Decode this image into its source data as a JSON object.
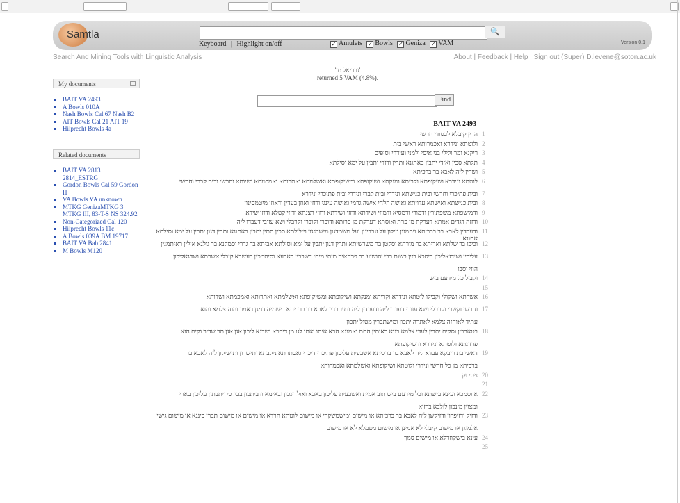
{
  "header": {
    "logo_text": "Samtla",
    "search": {
      "value": "",
      "placeholder": ""
    },
    "search_button": "🔍",
    "keyboard_link": "Keyboard",
    "separator": "|",
    "highlight_link": "Highlight on/off",
    "filters": [
      {
        "label": "Amulets",
        "checked": true
      },
      {
        "label": "Bowls",
        "checked": true
      },
      {
        "label": "Geniza",
        "checked": true
      },
      {
        "label": "VAM",
        "checked": true
      }
    ],
    "version": "Version 0.1"
  },
  "tagline": "Search And Mining Tools with Linguistic Analysis",
  "top_links": "About | Feedback | Help | Sign out (Super) D.levene@soton.ac.uk",
  "sidebar": {
    "my_documents_title": "My documents",
    "my_documents": [
      "BAIT VA 2493",
      "A Bowls 010A",
      "Nash Bowls Cal 67 Nash B2",
      "AIT Bowls Cal 21 AIT 19",
      "Hilprecht Bowls 4a"
    ],
    "related_title": "Related documents",
    "related": [
      "BAIT VA 2813 + 2814_ESTRG",
      "Gordon Bowls Cal 59 Gordon H",
      "VA Bowls VA unknown",
      "MTKG GenizaMTKG 3 MTKG III, 83-T-S NS 324.92",
      "Non-Categorized Cal 120",
      "Hilprecht Bowls 11c",
      "A Bowls 039A BM 19717",
      "BAIT VA Bab 2841",
      "M Bowls M120"
    ]
  },
  "results": {
    "query": "'גבריאל מן'",
    "summary": "returned 5 VAM (4.8%).",
    "find_value": "",
    "find_button": "Find"
  },
  "document": {
    "title": "BAIT VA 2493",
    "lines": [
      {
        "n": "1",
        "t": "הדין קיבלא לבסודי חרשי"
      },
      {
        "n": "2",
        "t": "ולוטתא ונידרא ואכמרותא ראשי בית"
      },
      {
        "n": "3",
        "t": "ריקנא ומר ולילי בני איסי ולמני ועידרי וסיפים"
      },
      {
        "n": "4",
        "t": "תלתא סכין ואזדי יתבין באתונא ותרין ודזדי יתבין על ימא וסילתא"
      },
      {
        "n": "5",
        "t": "ושרין ליה לאבא בר ברכיתא"
      },
      {
        "n": "6",
        "t": "לוטתא ונידרא ושיקופתא וקריתא ומנקתא ושיקופתא ומשיקופתא ואשלמתא ואתרותא ואמכמתא ושיותא וחרשי ובית קברי וחרשי"
      },
      {
        "n": "7",
        "t": "ובית פתיכרי וחרשי ובית כנישתא ונידרי ובית קברי ונידרי ובית פתיכרי ונידרא"
      },
      {
        "n": "8",
        "t": "ובית כנישתא ואישתא עדויתא ואישה הלחי אישה גרמי ואישה עינגי ודזזי ואוזן בעדין ודאוזן מיטמסינון"
      },
      {
        "n": "9",
        "t": "ודמישפתא משפתורין ודמורי ודמסיא ודמוזי ושידתא ודזזי ושידתא ודזזי רצנתא ודזזי קטלא ודזזי שידא"
      },
      {
        "n": "10",
        "t": "ודזזה דגדים אמתא דערקת מן פרת ואוסתא דערקת מן פרותא ודוכרי וקוברי וקרבלי ושא עזובי דעבדו ליה"
      },
      {
        "n": "11",
        "t": "ודעבדין לאבא בר ברכיתא ויתמנון ויילון על עבדיגון ועל משמדגון מישמזגון ויילולתא סכין תתין יתבין באתונא ותרין דגון יתבין על ימא וסילתא אתונא"
      },
      {
        "n": "12",
        "t": "וכיכו בר שלתא ואריתא בר מורתא וסקטן בר משרשיתא ותרין דגון יתבין על ימא וסילתא אביתא בר גדרי וסמקנא בר גולגא אילין ראיתמנין"
      },
      {
        "n": "13",
        "t": "עליכין ושידגאליכון דיסכא בזין בשום רבי יהושוע בר פרחאיה מיתי מיתי דשבבין בארעא וסיתמכין בעשרא קיבלי אשרתא ושדגאליכון"
      },
      {
        "n": "",
        "t": "הוזי וסבו"
      },
      {
        "n": "14",
        "t": "וקביל כל מידעם ביש"
      },
      {
        "n": "15",
        "t": ""
      },
      {
        "n": "16",
        "t": "אשרתא ושקולי וקבילו לוטתא ונידרא וקריתא ומנקתא ושיקופתא ומשיקופתא ואשלמתא ואתרותא ואמכמתא ושדותא"
      },
      {
        "n": "17",
        "t": "וחרשי וקשרי וקרבלי ושא עזובי דעבדו ליה ודעבדין ליה ודעתבדין לאבא בר ברכיתא בישמיה דמגן דאמר והוה צלמא והוא"
      },
      {
        "n": "",
        "t": "עתיד לאוחזה צלמא לאתרה יתכון ומישתכרין מטול יתכון"
      },
      {
        "n": "18",
        "t": "בטארבין וסקים יתבין לעדי צלמא בגוא ראותין התם ואמנגא הכא איתו ואתו לגו מן דיסכא ושדגא ליכון אגן אגן תר שדיר וקים הוא"
      },
      {
        "n": "",
        "t": "פרזונתא ולוטתא ונידרא ודשיקופתא"
      },
      {
        "n": "19",
        "t": "דאשי בת ריבקא עבדא ליה לאבא בר ברכיתא אשבעית עליכון פתיכרי דיכרי ואסתרתא ניקבתא ותישרון ותישיקון ליה לאבא בר"
      },
      {
        "n": "",
        "t": "ברכיתא מן כל חרשי ונידרי ולוטתא ושיקופתא ואשלמתא ואכמרותא"
      },
      {
        "n": "20",
        "t": "ניסי וק"
      },
      {
        "n": "21",
        "t": ""
      },
      {
        "n": "22",
        "t": "א וסמכא ועינא בישתא וכל מידעם ביש תוב אמית ואשבעית עליכון באבא ואולדינכון ובאימא ודביתכון בבידכי ויתבתון עליכון בארי"
      },
      {
        "n": "",
        "t": "ומצוין מינכון לזלבא ברזוא"
      },
      {
        "n": "23",
        "t": "ודזיק ודזיפרון ודזיקשן ליה לאבא בר ברכיתא או מישום ומישמשקרי או מישום לוטתא חרדא או מישום או מישום תברי כינגא או מישום גישי"
      },
      {
        "n": "",
        "t": "אלמוגן או מישום קיבלי לא אמינן או מישום מטמלא לא או מישום"
      },
      {
        "n": "24",
        "t": "עינא בישקוזדלא או מישום סמך"
      },
      {
        "n": "25",
        "t": ""
      }
    ]
  }
}
